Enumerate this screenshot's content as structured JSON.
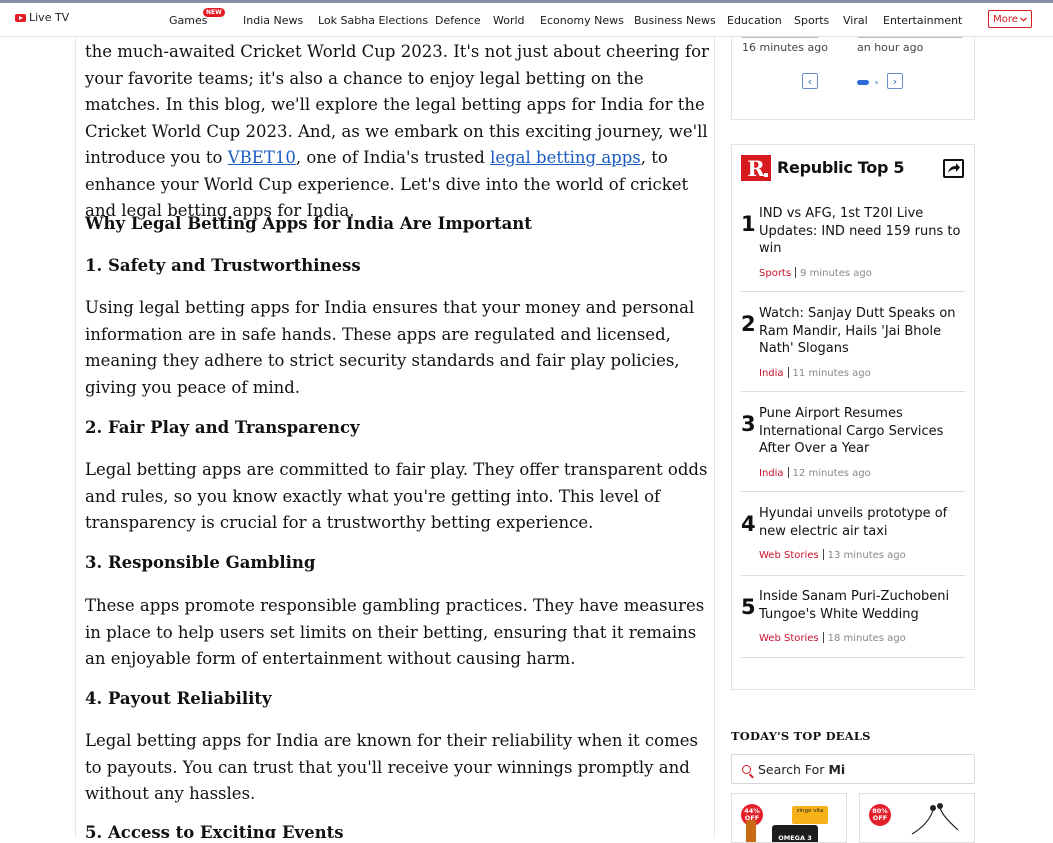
{
  "nav": {
    "live_tv": "Live TV",
    "items": [
      "Games",
      "India News",
      "Lok Sabha Elections",
      "Defence",
      "World",
      "Economy News",
      "Business News",
      "Education",
      "Sports",
      "Viral",
      "Entertainment"
    ],
    "games_badge": "NEW",
    "more": "More"
  },
  "article": {
    "intro": "the much-awaited Cricket World Cup 2023. It's not just about cheering for your favorite teams; it's also a chance to enjoy legal betting on the matches. In this blog, we'll explore the legal betting apps for India for the Cricket World Cup 2023. And, as we embark on this exciting journey, we'll introduce you to ",
    "link1": "VBET10",
    "intro_mid": ", one of India's trusted ",
    "link2": "legal betting apps",
    "intro_end": ", to enhance your World Cup experience. Let's dive into the world of cricket and legal betting apps for India.",
    "h_main": "Why Legal Betting Apps for India Are Important",
    "s1_title": "1. Safety and Trustworthiness",
    "s1_text": "Using legal betting apps for India ensures that your money and personal information are in safe hands. These apps are regulated and licensed, meaning they adhere to strict security standards and fair play policies, giving you peace of mind.",
    "s2_title": "2. Fair Play and Transparency",
    "s2_text": "Legal betting apps are committed to fair play. They offer transparent odds and rules, so you know exactly what you're getting into. This level of transparency is crucial for a trustworthy betting experience.",
    "s3_title": "3. Responsible Gambling",
    "s3_text": "These apps promote responsible gambling practices. They have measures in place to help users set limits on their betting, ensuring that it remains an enjoyable form of entertainment without causing harm.",
    "s4_title": "4. Payout Reliability",
    "s4_text": "Legal betting apps for India are known for their reliability when it comes to payouts. You can trust that you'll receive your winnings promptly and without any hassles.",
    "s5_title": "5. Access to Exciting Events"
  },
  "carousel": {
    "time1": "16 minutes ago",
    "time2": "an hour ago",
    "prev": "‹",
    "next": "›"
  },
  "top5": {
    "logo": "R",
    "title": "Republic Top 5",
    "stories": [
      {
        "num": "1",
        "headline": "IND vs AFG, 1st T20I Live Updates: IND need 159 runs to win",
        "category": "Sports",
        "time": "9 minutes ago"
      },
      {
        "num": "2",
        "headline": "Watch: Sanjay Dutt Speaks on Ram Mandir, Hails 'Jai Bhole Nath' Slogans",
        "category": "India",
        "time": "11 minutes ago"
      },
      {
        "num": "3",
        "headline": "Pune Airport Resumes International Cargo Services After Over a Year",
        "category": "India",
        "time": "12 minutes ago"
      },
      {
        "num": "4",
        "headline": "Hyundai unveils prototype of new electric air taxi",
        "category": "Web Stories",
        "time": "13 minutes ago"
      },
      {
        "num": "5",
        "headline": "Inside Sanam Puri-Zuchobeni Tungoe's White Wedding",
        "category": "Web Stories",
        "time": "18 minutes ago"
      }
    ]
  },
  "deals": {
    "title": "TODAY'S TOP DEALS",
    "search_prefix": "Search For",
    "search_term": "Mi",
    "cards": [
      {
        "off_pct": "44%",
        "off_word": "OFF",
        "product_brand": "zingo vita",
        "product_name": "OMEGA 3"
      },
      {
        "off_pct": "80%",
        "off_word": "OFF"
      }
    ]
  }
}
